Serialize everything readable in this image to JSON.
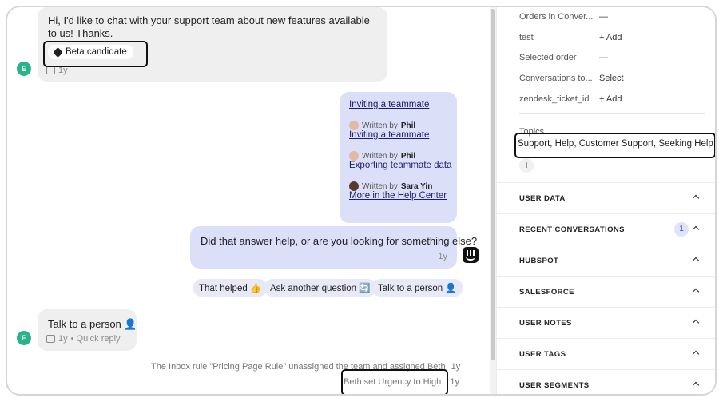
{
  "conversation": {
    "first_message": {
      "avatar_letter": "E",
      "text": "Hi, I'd like to chat with your support team about new features available to us! Thanks.",
      "tag": "Beta candidate",
      "time": "1y"
    },
    "bot_articles": [
      {
        "title": "Inviting a teammate",
        "written_by_label": null,
        "author": null
      },
      {
        "title": "Inviting a teammate",
        "written_by_label": "Written by",
        "author": "Phil"
      },
      {
        "title": "Exporting teammate data",
        "written_by_label": "Written by",
        "author": "Phil"
      },
      {
        "title": "More in the Help Center",
        "written_by_label": "Written by",
        "author": "Sara Yin"
      }
    ],
    "bot_question": {
      "text": "Did that answer help, or are you looking for something else?",
      "time": "1y"
    },
    "quick_replies": [
      "That helped 👍",
      "Ask another question 🔄",
      "Talk to a person 👤"
    ],
    "user_reply": {
      "avatar_letter": "E",
      "text": "Talk to a person 👤",
      "time": "1y",
      "meta_suffix": "• Quick reply"
    },
    "system_events": [
      {
        "text": "The Inbox rule \"Pricing Page Rule\" unassigned the team and assigned Beth",
        "time": "1y"
      },
      {
        "text": "Beth set Urgency to High",
        "time": "1y"
      }
    ]
  },
  "sidebar": {
    "attributes": [
      {
        "label": "Orders in Conver...",
        "value": "—"
      },
      {
        "label": "test",
        "value": "+ Add"
      },
      {
        "label": "Selected order",
        "value": "—"
      },
      {
        "label": "Conversations to...",
        "value": "Select"
      },
      {
        "label": "zendesk_ticket_id",
        "value": "+ Add"
      }
    ],
    "topics_label": "Topics",
    "topics_value": "Support, Help, Customer Support, Seeking Help",
    "add_topic": "+",
    "sections": [
      {
        "title": "USER DATA",
        "badge": null
      },
      {
        "title": "RECENT CONVERSATIONS",
        "badge": "1"
      },
      {
        "title": "HUBSPOT",
        "badge": null
      },
      {
        "title": "SALESFORCE",
        "badge": null
      },
      {
        "title": "USER NOTES",
        "badge": null
      },
      {
        "title": "USER TAGS",
        "badge": null
      },
      {
        "title": "USER SEGMENTS",
        "badge": null
      }
    ]
  },
  "colors": {
    "user_bubble": "#efefef",
    "bot_bubble": "#dcdff8",
    "avatar": "#29b38a"
  }
}
